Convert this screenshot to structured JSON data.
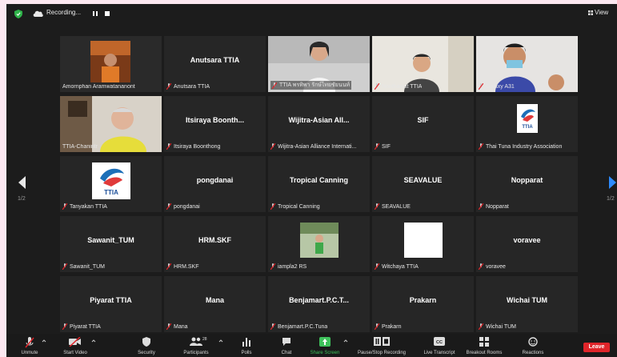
{
  "top_bar": {
    "recording_label": "Recording...",
    "view_label": "View"
  },
  "page_indicator_left": "1/2",
  "page_indicator_right": "1/2",
  "tiles": [
    {
      "big": "",
      "label": "Amornphan Aramwatananont"
    },
    {
      "big": "Anutsara TTIA",
      "label": "Anutsara TTIA"
    },
    {
      "big": "",
      "label": "TTIA พรทิพา รักษ์ไทยชัยนนท์"
    },
    {
      "big": "",
      "label": "Nonthawat TTIA"
    },
    {
      "big": "",
      "label": "Galaxy A31"
    },
    {
      "big": "",
      "label": "TTIA-Chanintr"
    },
    {
      "big": "Itsiraya Boonth...",
      "label": "Itsiraya Boonthong"
    },
    {
      "big": "Wijitra-Asian All...",
      "label": "Wijitra-Asian Alliance Internati..."
    },
    {
      "big": "SIF",
      "label": "SIF"
    },
    {
      "big": "",
      "label": "Thai Tuna Industry Association"
    },
    {
      "big": "",
      "label": "Tanyakan TTIA"
    },
    {
      "big": "pongdanai",
      "label": "pongdanai"
    },
    {
      "big": "Tropical Canning",
      "label": "Tropical Canning"
    },
    {
      "big": "SEAVALUE",
      "label": "SEAVALUE"
    },
    {
      "big": "Nopparat",
      "label": "Nopparat"
    },
    {
      "big": "Sawanit_TUM",
      "label": "Sawanit_TUM"
    },
    {
      "big": "HRM.SKF",
      "label": "HRM.SKF"
    },
    {
      "big": "",
      "label": "iampla2 RS"
    },
    {
      "big": "",
      "label": "Witchaya TTIA"
    },
    {
      "big": "voravee",
      "label": "voravee"
    },
    {
      "big": "Piyarat TTIA",
      "label": "Piyarat TTIA"
    },
    {
      "big": "Mana",
      "label": "Mana"
    },
    {
      "big": "Benjamart.P.C.T...",
      "label": "Benjamart.P.C.Tuna"
    },
    {
      "big": "Prakarn",
      "label": "Prakarn"
    },
    {
      "big": "Wichai TUM",
      "label": "Wichai TUM"
    }
  ],
  "logo_text": "TTIA",
  "toolbar": {
    "unmute": "Unmute",
    "start_video": "Start Video",
    "security": "Security",
    "participants": "Participants",
    "participants_count": "28",
    "polls": "Polls",
    "chat": "Chat",
    "share_screen": "Share Screen",
    "pause_recording": "Pause/Stop Recording",
    "live_transcript": "Live Transcript",
    "breakout_rooms": "Breakout Rooms",
    "reactions": "Reactions",
    "leave": "Leave"
  },
  "colors": {
    "active_speaker": "#9bd84c",
    "share_screen": "#3ec15b",
    "leave": "#e0252a",
    "muted_mic": "#e0252a"
  }
}
